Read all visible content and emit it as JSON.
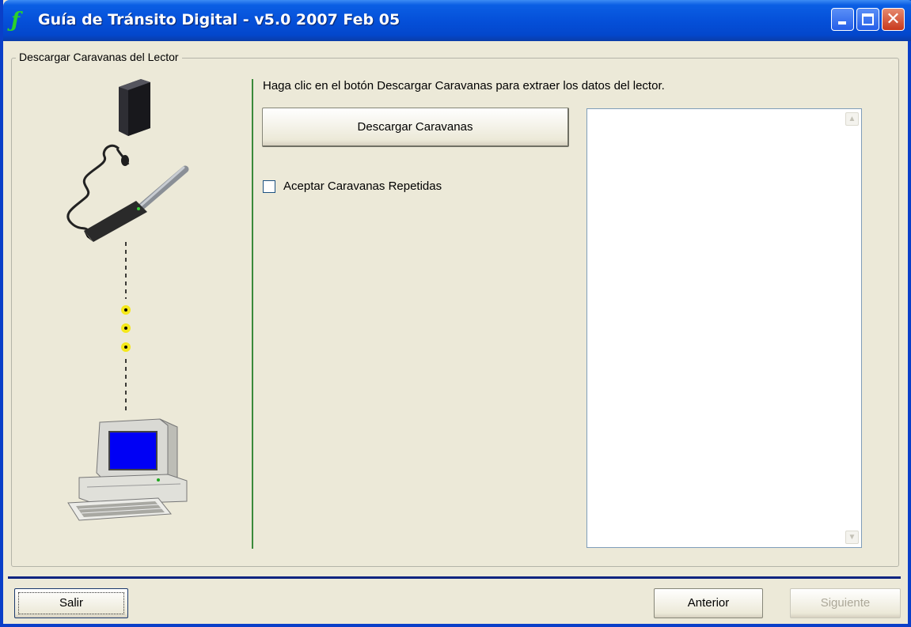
{
  "window": {
    "title": "Guía de Tránsito Digital - v5.0 2007 Feb 05",
    "app_icon": "f-icon",
    "controls": [
      "minimize",
      "maximize",
      "close"
    ]
  },
  "group": {
    "legend": "Descargar Caravanas del Lector"
  },
  "illustration": {
    "icons": [
      "reader-box-icon",
      "wand-reader-icon",
      "connection-dots",
      "computer-icon"
    ]
  },
  "main": {
    "instructions": "Haga clic en el botón Descargar Caravanas para extraer los datos del lector.",
    "download_button": "Descargar Caravanas",
    "checkbox_label": "Aceptar Caravanas Repetidas",
    "checkbox_checked": false,
    "list_items": []
  },
  "footer": {
    "exit_button": "Salir",
    "back_button": "Anterior",
    "next_button": "Siguiente",
    "next_enabled": false
  },
  "colors": {
    "titlebar": "#0550d9",
    "background": "#ece9d8",
    "divider": "#3a8a3a",
    "separator": "#0b2480"
  }
}
